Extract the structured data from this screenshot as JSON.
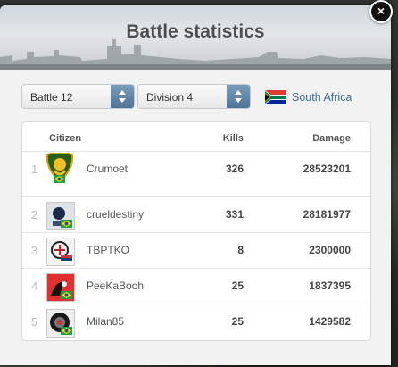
{
  "modal": {
    "title": "Battle statistics",
    "close_symbol": "×"
  },
  "filters": {
    "battle_select": "Battle 12",
    "division_select": "Division 4",
    "country": "South Africa"
  },
  "table": {
    "headers": {
      "citizen": "Citizen",
      "kills": "Kills",
      "damage": "Damage"
    },
    "rows": [
      {
        "rank": "1",
        "name": "Crumoet",
        "kills": "326",
        "damage": "28523201",
        "flag": "brazil"
      },
      {
        "rank": "2",
        "name": "crueldestiny",
        "kills": "331",
        "damage": "28181977",
        "flag": "brazil"
      },
      {
        "rank": "3",
        "name": "TBPTKO",
        "kills": "8",
        "damage": "2300000",
        "flag": "serbia"
      },
      {
        "rank": "4",
        "name": "PeeKaBooh",
        "kills": "25",
        "damage": "1837395",
        "flag": "brazil"
      },
      {
        "rank": "5",
        "name": "Milan85",
        "kills": "25",
        "damage": "1429582",
        "flag": "brazil"
      }
    ]
  },
  "colors": {
    "country_link": "#3a6e99",
    "select_arrow": "#5a7fa3",
    "title_text": "#4c4f52"
  }
}
